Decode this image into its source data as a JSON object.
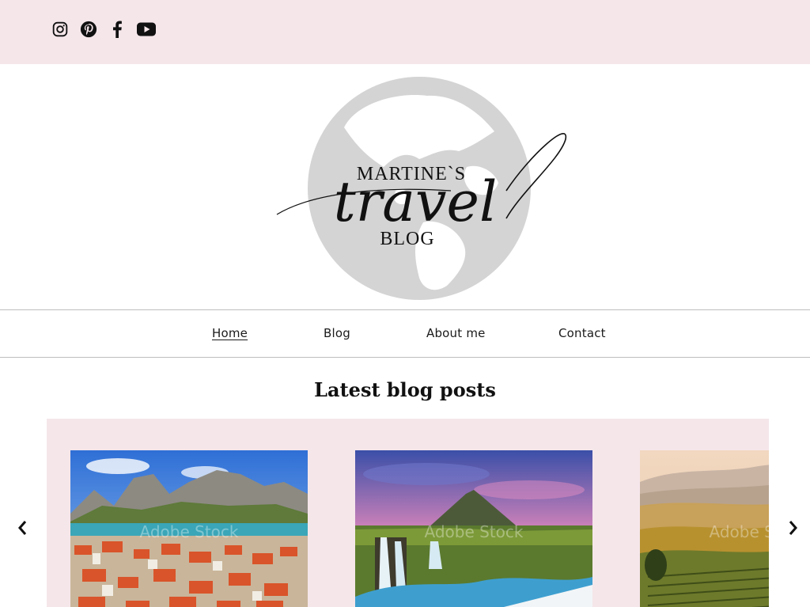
{
  "social": {
    "icons": [
      "instagram-icon",
      "pinterest-icon",
      "facebook-icon",
      "youtube-icon"
    ]
  },
  "logo": {
    "line1": "MARTINE`S",
    "script": "travel",
    "line3": "BLOG"
  },
  "nav": {
    "items": [
      "Home",
      "Blog",
      "About me",
      "Contact"
    ],
    "active": "Home"
  },
  "main": {
    "section_title": "Latest blog posts"
  },
  "carousel": {
    "posts": [
      {
        "image": "coastal-town-mountains"
      },
      {
        "image": "waterfall-mountain-sunset"
      },
      {
        "image": "rolling-hills-vineyard"
      }
    ],
    "watermark": "Adobe Stock",
    "prev_icon": "chevron-left-icon",
    "next_icon": "chevron-right-icon"
  },
  "colors": {
    "accent_pink": "#f5e6ea",
    "globe_gray": "#d4d4d4"
  }
}
